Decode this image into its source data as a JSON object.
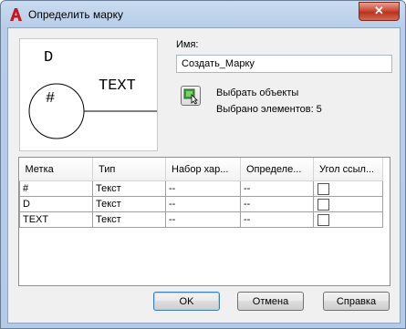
{
  "window": {
    "title": "Определить марку",
    "close_symbol": "✕"
  },
  "preview": {
    "attr_tag_d": "D",
    "attr_tag_hash": "#",
    "attr_tag_text": "TEXT"
  },
  "form": {
    "name_label": "Имя:",
    "name_value": "Создать_Марку",
    "select_objects_label": "Выбрать объекты",
    "selected_count_label": "Выбрано элементов: 5"
  },
  "grid": {
    "columns": [
      "Метка",
      "Тип",
      "Набор хар...",
      "Определе...",
      "Угол ссыл..."
    ],
    "rows": [
      {
        "tag": "#",
        "type": "Текст",
        "set": "--",
        "definition": "--",
        "ref_angle_checked": false
      },
      {
        "tag": "D",
        "type": "Текст",
        "set": "--",
        "definition": "--",
        "ref_angle_checked": false
      },
      {
        "tag": "TEXT",
        "type": "Текст",
        "set": "--",
        "definition": "--",
        "ref_angle_checked": false
      }
    ]
  },
  "buttons": {
    "ok": "OK",
    "cancel": "Отмена",
    "help": "Справка"
  }
}
